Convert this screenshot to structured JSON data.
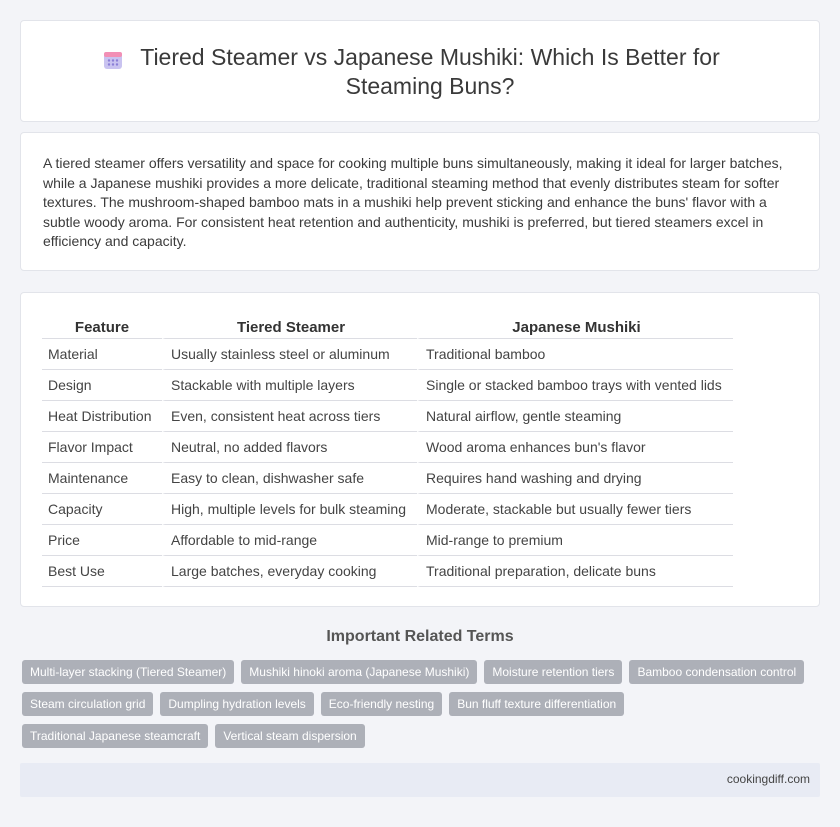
{
  "header": {
    "title": "Tiered Steamer vs Japanese Mushiki: Which Is Better for Steaming Buns?",
    "icon": "calendar-icon"
  },
  "summary": "A tiered steamer offers versatility and space for cooking multiple buns simultaneously, making it ideal for larger batches, while a Japanese mushiki provides a more delicate, traditional steaming method that evenly distributes steam for softer textures. The mushroom-shaped bamboo mats in a mushiki help prevent sticking and enhance the buns' flavor with a subtle woody aroma. For consistent heat retention and authenticity, mushiki is preferred, but tiered steamers excel in efficiency and capacity.",
  "table": {
    "headers": [
      "Feature",
      "Tiered Steamer",
      "Japanese Mushiki"
    ],
    "rows": [
      [
        "Material",
        "Usually stainless steel or aluminum",
        "Traditional bamboo"
      ],
      [
        "Design",
        "Stackable with multiple layers",
        "Single or stacked bamboo trays with vented lids"
      ],
      [
        "Heat Distribution",
        "Even, consistent heat across tiers",
        "Natural airflow, gentle steaming"
      ],
      [
        "Flavor Impact",
        "Neutral, no added flavors",
        "Wood aroma enhances bun's flavor"
      ],
      [
        "Maintenance",
        "Easy to clean, dishwasher safe",
        "Requires hand washing and drying"
      ],
      [
        "Capacity",
        "High, multiple levels for bulk steaming",
        "Moderate, stackable but usually fewer tiers"
      ],
      [
        "Price",
        "Affordable to mid-range",
        "Mid-range to premium"
      ],
      [
        "Best Use",
        "Large batches, everyday cooking",
        "Traditional preparation, delicate buns"
      ]
    ]
  },
  "related": {
    "title": "Important Related Terms",
    "tags": [
      [
        "Multi-layer stacking (Tiered Steamer)",
        "Mushiki hinoki aroma (Japanese Mushiki)",
        "Moisture retention tiers",
        "Bamboo condensation control"
      ],
      [
        "Steam circulation grid",
        "Dumpling hydration levels",
        "Eco-friendly nesting",
        "Bun fluff texture differentiation"
      ],
      [
        "Traditional Japanese steamcraft",
        "Vertical steam dispersion"
      ]
    ]
  },
  "footer": {
    "site": "cookingdiff.com"
  },
  "colors": {
    "background": "#f3f4f8",
    "tag": "#adb0b8",
    "footer": "#e8ebf4",
    "icon_accent": "#8b7fd6"
  }
}
